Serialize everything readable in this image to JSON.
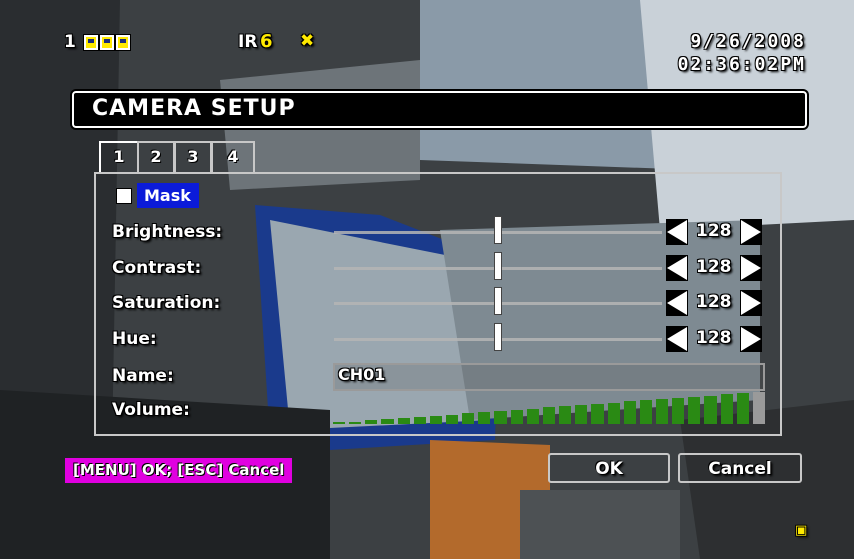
{
  "status": {
    "channel_number": "1",
    "ir_label": "IR",
    "ir_value": "6",
    "date": "9/26/2008",
    "time": "02:36:02PM"
  },
  "dialog": {
    "title": "CAMERA SETUP",
    "tabs": [
      {
        "label": "1",
        "active": true
      },
      {
        "label": "2",
        "active": false
      },
      {
        "label": "3",
        "active": false
      },
      {
        "label": "4",
        "active": false
      }
    ],
    "mask": {
      "label": "Mask",
      "checked": false
    },
    "sliders": [
      {
        "label": "Brightness:",
        "value": "128",
        "level": 0.5
      },
      {
        "label": "Contrast:",
        "value": "128",
        "level": 0.5
      },
      {
        "label": "Saturation:",
        "value": "128",
        "level": 0.5
      },
      {
        "label": "Hue:",
        "value": "128",
        "level": 0.5
      }
    ],
    "name": {
      "label": "Name:",
      "value": "CH01"
    },
    "volume": {
      "label": "Volume:",
      "level_steps": 26,
      "total_steps": 27
    },
    "help_text": "[MENU] OK; [ESC] Cancel",
    "ok_label": "OK",
    "cancel_label": "Cancel"
  },
  "icons": {
    "speaker": "speaker-muted-icon",
    "corner": "record-indicator-icon"
  },
  "colors": {
    "accent_yellow": "#ffea00",
    "mask_highlight": "#0b1bd9",
    "help_bg": "#e000e0",
    "volume_green": "#2a8a14"
  }
}
